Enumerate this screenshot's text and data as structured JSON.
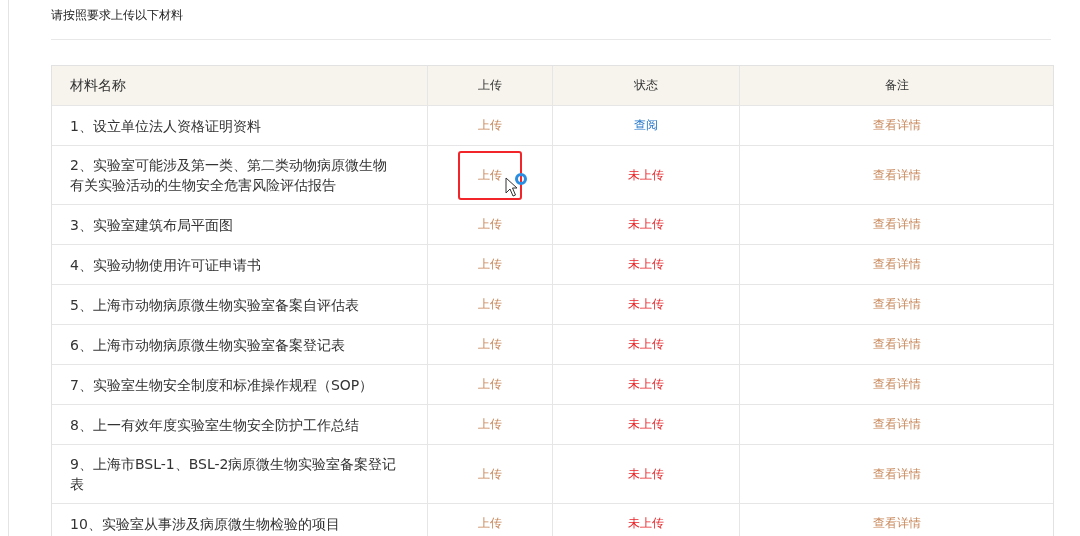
{
  "instruction": "请按照要求上传以下材料",
  "table": {
    "columns": [
      "材料名称",
      "上传",
      "状态",
      "备注"
    ],
    "rows": [
      {
        "name": "1、设立单位法人资格证明资料",
        "upload": "上传",
        "highlighted": false,
        "status": {
          "text": "查阅",
          "kind": "viewable"
        },
        "note": "查看详情"
      },
      {
        "name": "2、实验室可能涉及第一类、第二类动物病原微生物有关实验活动的生物安全危害风险评估报告",
        "upload": "上传",
        "highlighted": true,
        "status": {
          "text": "未上传",
          "kind": "missing"
        },
        "note": "查看详情"
      },
      {
        "name": "3、实验室建筑布局平面图",
        "upload": "上传",
        "highlighted": false,
        "status": {
          "text": "未上传",
          "kind": "missing"
        },
        "note": "查看详情"
      },
      {
        "name": "4、实验动物使用许可证申请书",
        "upload": "上传",
        "highlighted": false,
        "status": {
          "text": "未上传",
          "kind": "missing"
        },
        "note": "查看详情"
      },
      {
        "name": "5、上海市动物病原微生物实验室备案自评估表",
        "upload": "上传",
        "highlighted": false,
        "status": {
          "text": "未上传",
          "kind": "missing"
        },
        "note": "查看详情"
      },
      {
        "name": "6、上海市动物病原微生物实验室备案登记表",
        "upload": "上传",
        "highlighted": false,
        "status": {
          "text": "未上传",
          "kind": "missing"
        },
        "note": "查看详情"
      },
      {
        "name": "7、实验室生物安全制度和标准操作规程（SOP）",
        "upload": "上传",
        "highlighted": false,
        "status": {
          "text": "未上传",
          "kind": "missing"
        },
        "note": "查看详情"
      },
      {
        "name": "8、上一有效年度实验室生物安全防护工作总结",
        "upload": "上传",
        "highlighted": false,
        "status": {
          "text": "未上传",
          "kind": "missing"
        },
        "note": "查看详情"
      },
      {
        "name": "9、上海市BSL-1、BSL-2病原微生物实验室备案登记表",
        "upload": "上传",
        "highlighted": false,
        "status": {
          "text": "未上传",
          "kind": "missing"
        },
        "note": "查看详情"
      },
      {
        "name": "10、实验室从事涉及病原微生物检验的项目",
        "upload": "上传",
        "highlighted": false,
        "status": {
          "text": "未上传",
          "kind": "missing"
        },
        "note": "查看详情"
      }
    ]
  }
}
